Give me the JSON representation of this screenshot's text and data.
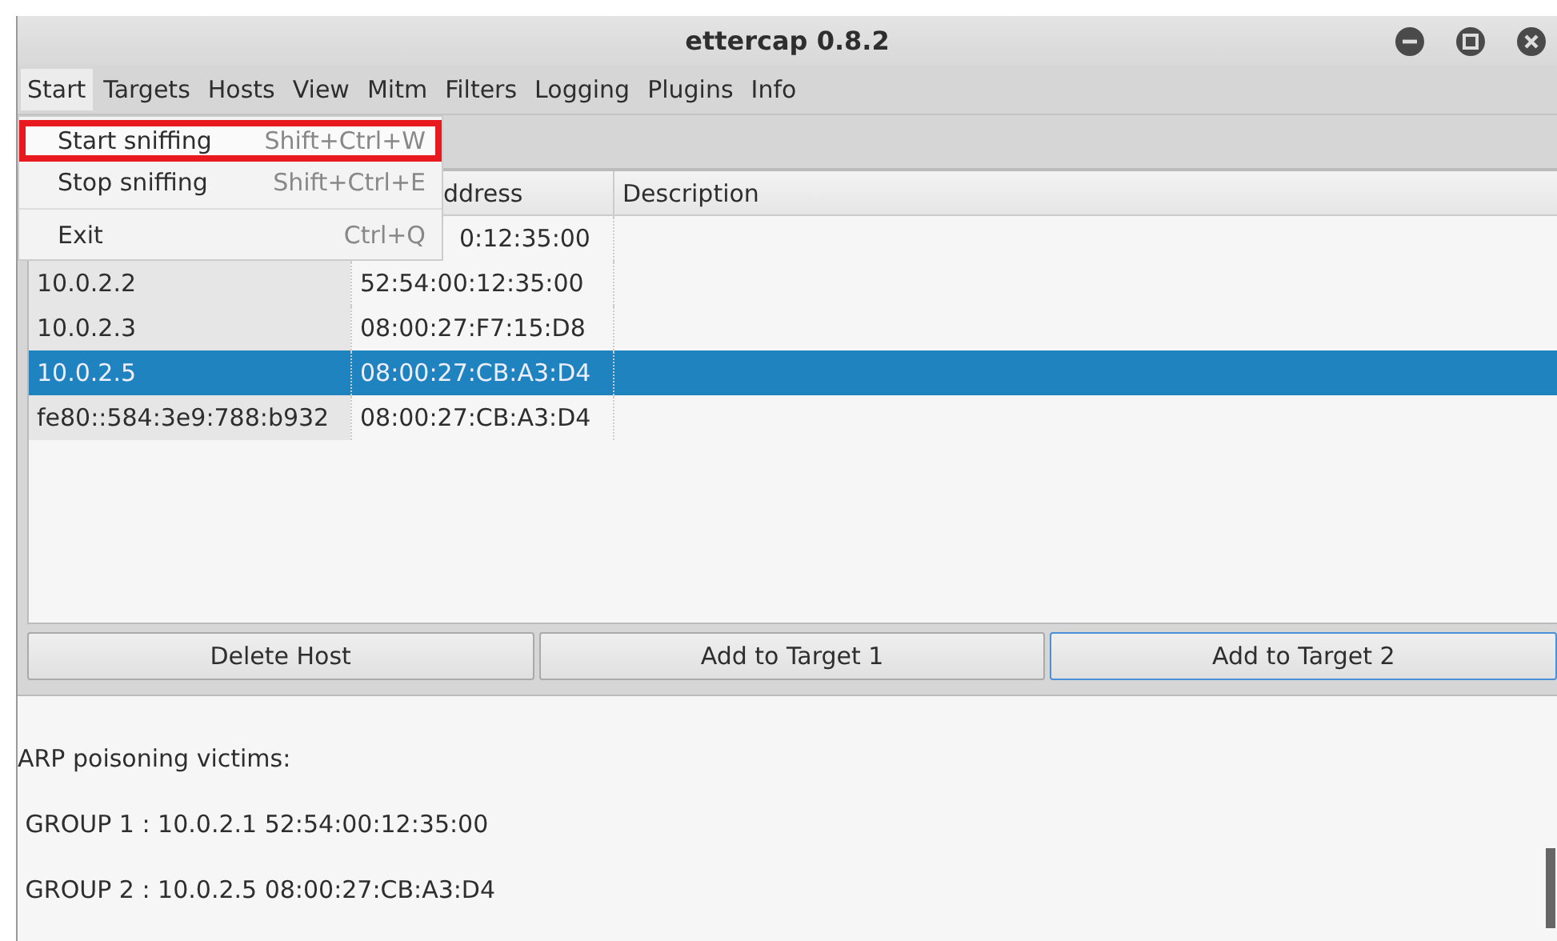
{
  "window": {
    "title": "ettercap 0.8.2"
  },
  "menubar": [
    {
      "label": "Start",
      "selected": true
    },
    {
      "label": "Targets",
      "selected": false
    },
    {
      "label": "Hosts",
      "selected": false
    },
    {
      "label": "View",
      "selected": false
    },
    {
      "label": "Mitm",
      "selected": false
    },
    {
      "label": "Filters",
      "selected": false
    },
    {
      "label": "Logging",
      "selected": false
    },
    {
      "label": "Plugins",
      "selected": false
    },
    {
      "label": "Info",
      "selected": false
    }
  ],
  "menu": [
    {
      "kind": "item",
      "label": "Start sniffing",
      "shortcut": "Shift+Ctrl+W",
      "highlighted": true
    },
    {
      "kind": "item",
      "label": "Stop sniffing",
      "shortcut": "Shift+Ctrl+E",
      "highlighted": false
    },
    {
      "kind": "separator"
    },
    {
      "kind": "item",
      "label": "Exit",
      "shortcut": "Ctrl+Q",
      "highlighted": false
    }
  ],
  "table": {
    "columns": [
      "ddress",
      "Description"
    ],
    "rows": [
      {
        "ip": "",
        "mac": "0:12:35:00",
        "selected": false
      },
      {
        "ip": "10.0.2.2",
        "mac": "52:54:00:12:35:00",
        "selected": false
      },
      {
        "ip": "10.0.2.3",
        "mac": "08:00:27:F7:15:D8",
        "selected": false
      },
      {
        "ip": "10.0.2.5",
        "mac": "08:00:27:CB:A3:D4",
        "selected": true
      },
      {
        "ip": "fe80::584:3e9:788:b932",
        "mac": "08:00:27:CB:A3:D4",
        "selected": false
      }
    ]
  },
  "buttons": [
    {
      "label": "Delete Host",
      "focused": false
    },
    {
      "label": "Add to Target 1",
      "focused": false
    },
    {
      "label": "Add to Target 2",
      "focused": true
    }
  ],
  "log": [
    "ARP poisoning victims:",
    " GROUP 1 : 10.0.2.1 52:54:00:12:35:00",
    " GROUP 2 : 10.0.2.5 08:00:27:CB:A3:D4"
  ]
}
